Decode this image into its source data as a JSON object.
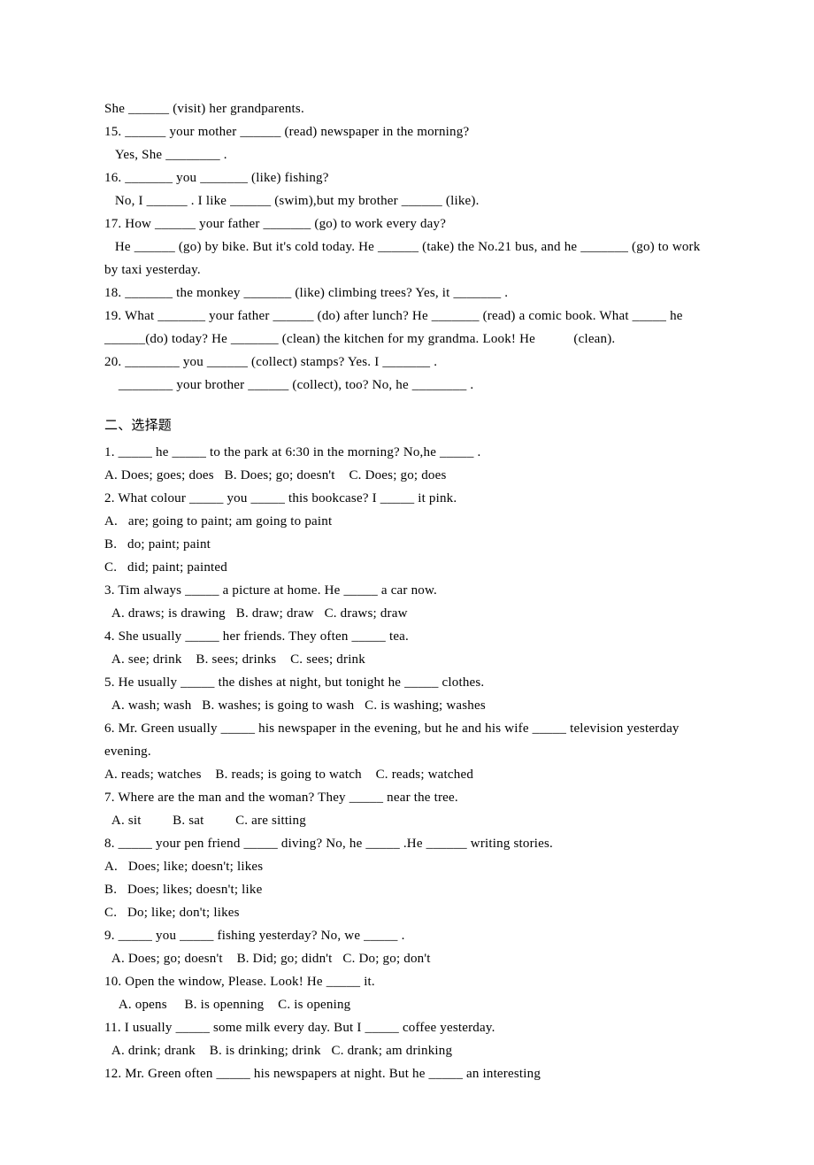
{
  "fill_in": {
    "items": [
      {
        "lines": [
          "She ______ (visit) her grandparents."
        ]
      },
      {
        "lines": [
          "15. ______ your mother ______ (read) newspaper in the morning?",
          "   Yes, She ________ ."
        ]
      },
      {
        "lines": [
          "16. _______ you _______ (like) fishing?",
          "   No, I ______ . I like ______ (swim),but my brother ______ (like)."
        ]
      },
      {
        "lines": [
          "17. How ______ your father _______ (go) to work every day?",
          "   He ______ (go) by bike. But it's cold today. He ______ (take) the No.21 bus, and he _______ (go) to work by taxi yesterday."
        ]
      },
      {
        "lines": [
          "18. _______ the monkey _______ (like) climbing trees? Yes, it _______ ."
        ]
      },
      {
        "lines": [
          "19. What _______ your father ______ (do) after lunch? He _______ (read) a comic book. What _____ he ______(do) today? He _______ (clean) the kitchen for my grandma. Look! He           (clean)."
        ]
      },
      {
        "lines": [
          "20. ________ you ______ (collect) stamps? Yes. I _______ .",
          "    ________ your brother ______ (collect), too? No, he ________ ."
        ]
      }
    ]
  },
  "section2": {
    "heading": "二、选择题",
    "items": [
      {
        "q": "1. _____ he _____ to the park at 6:30 in the morning? No,he _____ .",
        "opts": "A. Does; goes; does   B. Does; go; doesn't    C. Does; go; does"
      },
      {
        "q": "2. What colour _____ you _____ this bookcase? I _____ it pink.",
        "opts": [
          "A.   are; going to paint; am going to paint",
          "B.   do; paint; paint",
          "C.   did; paint; painted"
        ]
      },
      {
        "q": "3. Tim always _____ a picture at home. He _____ a car now.",
        "opts": "  A. draws; is drawing   B. draw; draw   C. draws; draw"
      },
      {
        "q": "4. She usually _____ her friends. They often _____ tea.",
        "opts": "  A. see; drink    B. sees; drinks    C. sees; drink"
      },
      {
        "q": "5. He usually _____ the dishes at night, but tonight he _____ clothes.",
        "opts": "  A. wash; wash   B. washes; is going to wash   C. is washing; washes"
      },
      {
        "q": "6. Mr. Green usually _____ his newspaper in the evening, but he and his wife _____ television yesterday evening.",
        "opts": "A. reads; watches    B. reads; is going to watch    C. reads; watched"
      },
      {
        "q": "7. Where are the man and the woman? They _____ near the tree.",
        "opts": "  A. sit         B. sat         C. are sitting"
      },
      {
        "q": "8. _____ your pen friend _____ diving? No, he _____ .He ______ writing stories.",
        "opts": [
          "A.   Does; like; doesn't; likes",
          "B.   Does; likes; doesn't; like",
          "C.   Do; like; don't; likes"
        ]
      },
      {
        "q": "9. _____ you _____ fishing yesterday? No, we _____ .",
        "opts": "  A. Does; go; doesn't    B. Did; go; didn't   C. Do; go; don't"
      },
      {
        "q": "10. Open the window, Please. Look! He _____ it.",
        "opts": "    A. opens     B. is openning    C. is opening"
      },
      {
        "q": "11. I usually _____ some milk every day. But I _____ coffee yesterday.",
        "opts": "  A. drink; drank    B. is drinking; drink   C. drank; am drinking"
      },
      {
        "q": "12. Mr. Green often _____ his newspapers at night. But he _____ an interesting"
      }
    ]
  }
}
